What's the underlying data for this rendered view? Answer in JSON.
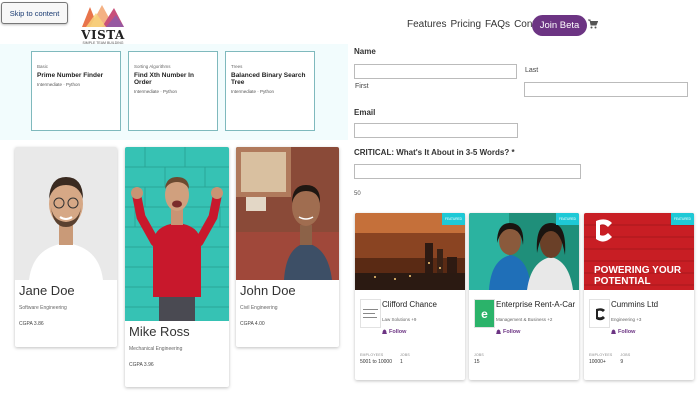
{
  "header": {
    "skip_label": "Skip to content",
    "logo_word": "VISTA",
    "logo_tagline": "SIMPLE TEAM BUILDING",
    "nav": [
      "Features",
      "Pricing",
      "FAQs",
      "Contact"
    ],
    "join_label": "Join Beta",
    "cart_icon": "cart-icon"
  },
  "problems": [
    {
      "label": "Basic",
      "title": "Prime Number Finder",
      "meta": "Intermediate · Python"
    },
    {
      "label": "Sorting Algorithms",
      "title": "Find Xth Number In Order",
      "meta": "Intermediate · Python"
    },
    {
      "label": "Trees",
      "title": "Balanced Binary Search Tree",
      "meta": "Intermediate · Python"
    }
  ],
  "people": [
    {
      "name": "Jane Doe",
      "major": "Software Engineering",
      "gpa": "CGPA 3.86"
    },
    {
      "name": "Mike Ross",
      "major": "Mechanical Engineering",
      "gpa": "CGPA 3.96"
    },
    {
      "name": "John Doe",
      "major": "Civil Engineering",
      "gpa": "CGPA 4.00"
    }
  ],
  "form": {
    "name_label": "Name",
    "first_label": "First",
    "last_label": "Last",
    "email_label": "Email",
    "critical_label": "CRITICAL: What's It About in 3-5 Words? *",
    "char_count": "50"
  },
  "companies": [
    {
      "badge": "FEATURED",
      "name": "Clifford Chance",
      "industry": "Law Solutions +9",
      "follow": "Follow",
      "stats": [
        {
          "k": "EMPLOYEES",
          "v": "5001 to 10000"
        },
        {
          "k": "JOBS",
          "v": "1"
        }
      ]
    },
    {
      "badge": "FEATURED",
      "name": "Enterprise Rent-A-Car",
      "industry": "Management & Business +2",
      "follow": "Follow",
      "stats": [
        {
          "k": "JOBS",
          "v": "15"
        }
      ]
    },
    {
      "badge": "FEATURED",
      "name": "Cummins Ltd",
      "industry": "Engineering +3",
      "follow": "Follow",
      "banner_text": "POWERING YOUR POTENTIAL",
      "stats": [
        {
          "k": "EMPLOYEES",
          "v": "10000+"
        },
        {
          "k": "JOBS",
          "v": "9"
        }
      ]
    }
  ],
  "colors": {
    "accent": "#6c3483",
    "featured": "#1ec9d6",
    "panel": "#f2fcfd"
  }
}
